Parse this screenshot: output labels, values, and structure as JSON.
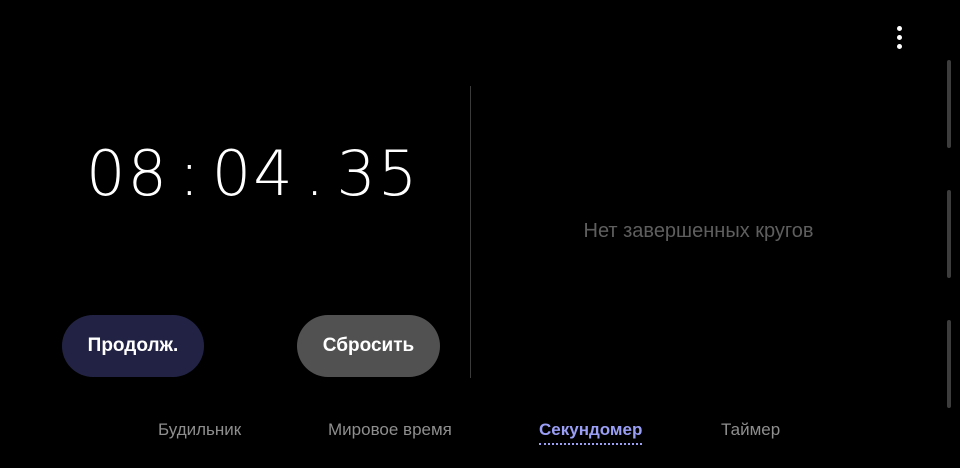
{
  "toolbar": {
    "more_icon": "more-vert-icon"
  },
  "stopwatch": {
    "minutes": "08",
    "separator1": ":",
    "seconds": "04",
    "separator2": ".",
    "hundredths": "35"
  },
  "laps": {
    "empty_text": "Нет завершенных кругов"
  },
  "buttons": {
    "resume_label": "Продолж.",
    "reset_label": "Сбросить"
  },
  "tabs": [
    {
      "label": "Будильник",
      "active": false
    },
    {
      "label": "Мировое время",
      "active": false
    },
    {
      "label": "Секундомер",
      "active": true
    },
    {
      "label": "Таймер",
      "active": false
    }
  ],
  "colors": {
    "background": "#000000",
    "active_tab": "#9a9ef5",
    "resume_button": "#222344",
    "reset_button": "#515151"
  }
}
